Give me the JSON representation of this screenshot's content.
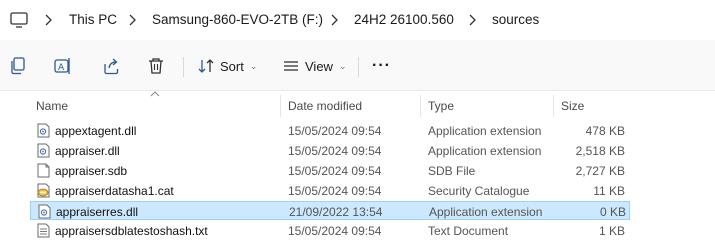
{
  "address_bar": {
    "icon": "monitor-icon",
    "breadcrumbs": [
      "This PC",
      "Samsung-860-EVO-2TB (F:)",
      "24H2 26100.560",
      "sources"
    ]
  },
  "toolbar": {
    "icons": [
      "copy-icon",
      "rename-icon",
      "share-icon",
      "delete-icon"
    ],
    "sort_label": "Sort",
    "view_label": "View",
    "more_label": "···"
  },
  "columns": {
    "name": "Name",
    "date": "Date modified",
    "type": "Type",
    "size": "Size"
  },
  "files": [
    {
      "name": "appextagent.dll",
      "date": "15/05/2024 09:54",
      "type": "Application extension",
      "size": "478 KB",
      "icon": "dll-file-icon",
      "selected": false
    },
    {
      "name": "appraiser.dll",
      "date": "15/05/2024 09:54",
      "type": "Application extension",
      "size": "2,518 KB",
      "icon": "dll-file-icon",
      "selected": false
    },
    {
      "name": "appraiser.sdb",
      "date": "15/05/2024 09:54",
      "type": "SDB File",
      "size": "2,727 KB",
      "icon": "blank-file-icon",
      "selected": false
    },
    {
      "name": "appraiserdatasha1.cat",
      "date": "15/05/2024 09:54",
      "type": "Security Catalogue",
      "size": "11 KB",
      "icon": "catalog-file-icon",
      "selected": false
    },
    {
      "name": "appraiserres.dll",
      "date": "21/09/2022 13:54",
      "type": "Application extension",
      "size": "0 KB",
      "icon": "dll-file-icon",
      "selected": true
    },
    {
      "name": "appraisersdblatestoshash.txt",
      "date": "15/05/2024 09:54",
      "type": "Text Document",
      "size": "1 KB",
      "icon": "text-file-icon",
      "selected": false
    }
  ],
  "colors": {
    "selection_bg": "#cce8ff",
    "selection_border": "#99d1ff",
    "toolbar_bg": "#f9f9f9"
  }
}
